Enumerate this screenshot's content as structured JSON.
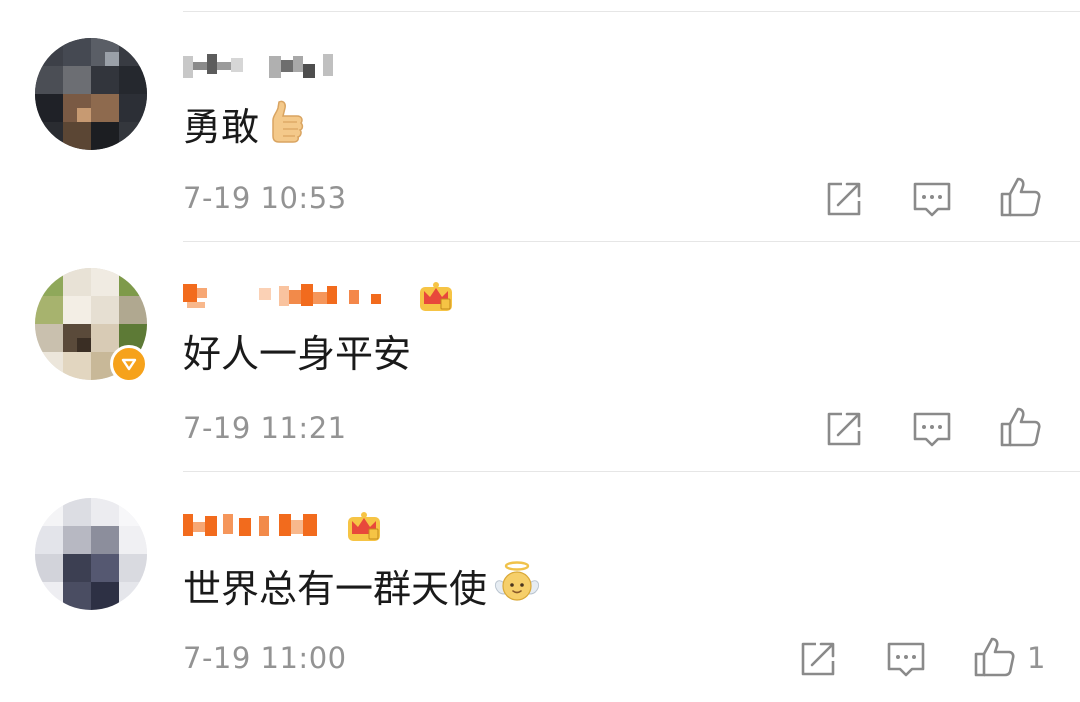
{
  "icons": {
    "share": "share-icon",
    "comment": "comment-icon",
    "like": "thumbs-up-icon",
    "crown": "vip-crown-icon"
  },
  "colors": {
    "timestamp": "#939393",
    "icon": "#8a8a8a",
    "vip_name": "#f26b1d",
    "vip_badge": "#f6a21b",
    "divider": "#e6e6e6"
  },
  "comments": [
    {
      "content": "勇敢",
      "emoji": "thumbs-up-emoji",
      "timestamp": "7-19 10:53",
      "vip": false,
      "like_count": ""
    },
    {
      "content": "好人一身平安",
      "emoji": "",
      "timestamp": "7-19 11:21",
      "vip": true,
      "like_count": ""
    },
    {
      "content": "世界总有一群天使",
      "emoji": "angel-emoji",
      "timestamp": "7-19 11:00",
      "vip": true,
      "like_count": "1"
    }
  ]
}
